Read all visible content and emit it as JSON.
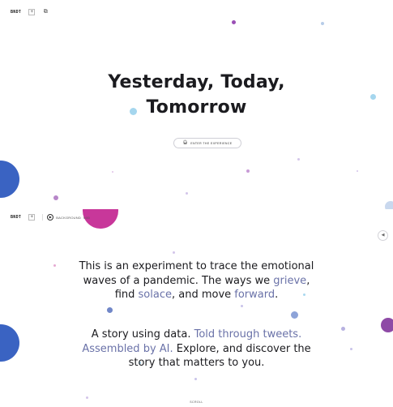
{
  "top_panel": {
    "logo": "BNDT",
    "add_icon": "plus-square-icon",
    "copy_icon": "copy-icon",
    "title_line1": "Yesterday, Today,",
    "title_line2": "Tomorrow",
    "cta_label": "ENTER THE EXPERIENCE",
    "cta_icon": "headphones-icon"
  },
  "bottom_panel": {
    "logo": "BNDT",
    "player": {
      "track": "BACKGROUND",
      "time": "0:00",
      "play_icon": "play-circle-icon"
    },
    "sound_icon": "sound-toggle-icon",
    "intro": {
      "p1": "This is an experiment to trace the emotional",
      "p2": "waves of a pandemic. The ways we ",
      "w_grieve": "grieve",
      "comma1": ",",
      "p3": "find ",
      "w_solace": "solace",
      "p4": ", and move ",
      "w_forward": "forward",
      "p5": "."
    },
    "story": {
      "p1": "A story using data. ",
      "w_told": "Told through tweets.",
      "w_assembled": "Assembled by AI.",
      "p2": " Explore, and discover the",
      "p3": "story that matters to you."
    },
    "scroll_label": "SCROLL"
  },
  "colors": {
    "text": "#1b1b1f",
    "accent": "#6a72a8",
    "blue": "#3b66c4",
    "magenta": "#c8379a",
    "purple": "#8e4aa6",
    "light_blue": "#a9d8ef",
    "lavender": "#c9c3ea"
  }
}
